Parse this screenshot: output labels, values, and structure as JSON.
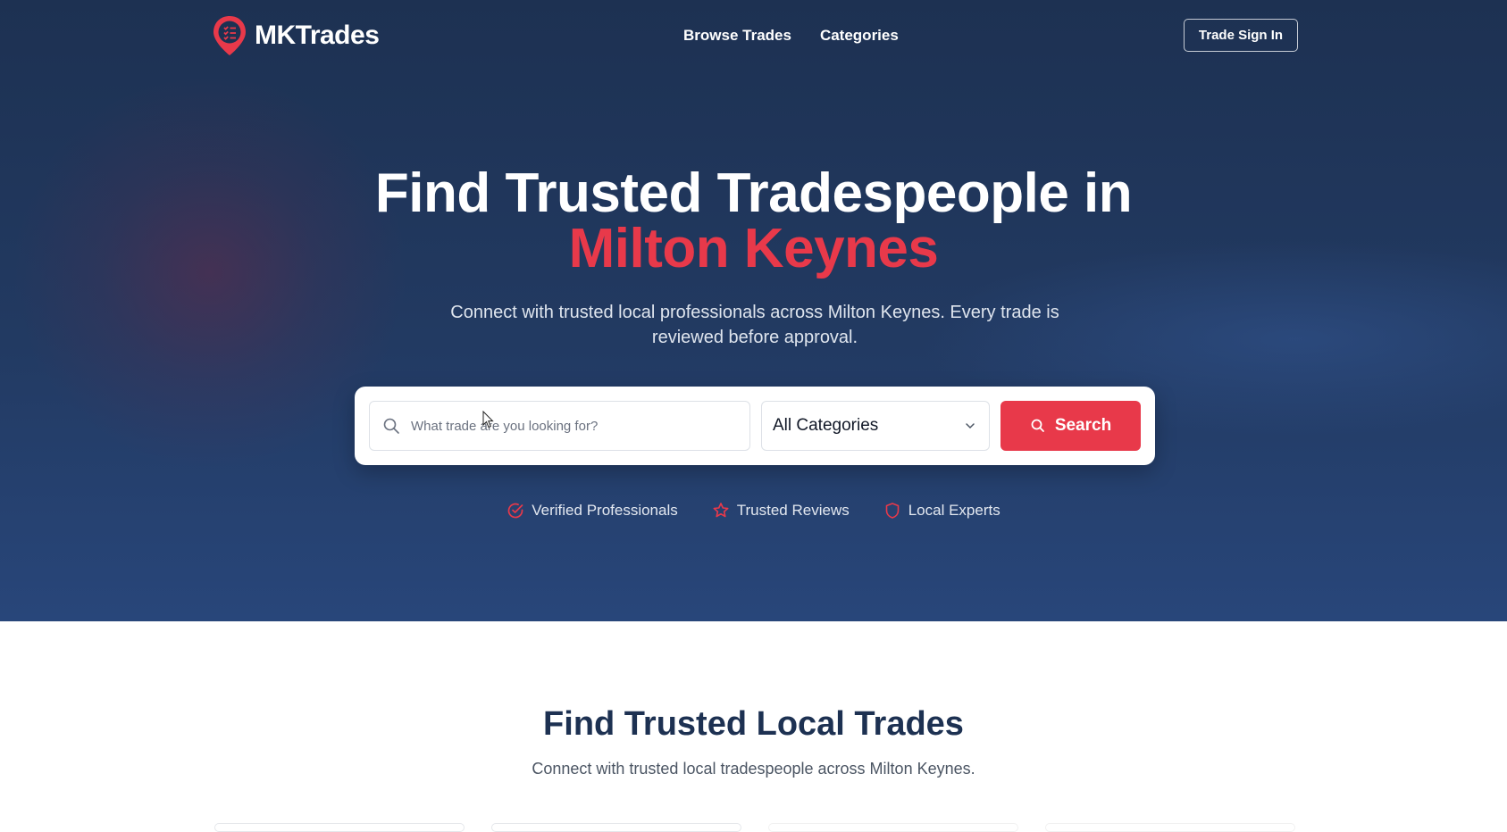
{
  "header": {
    "brand": "MKTrades",
    "nav": [
      "Browse Trades",
      "Categories"
    ],
    "signin_label": "Trade Sign In"
  },
  "hero": {
    "headline": "Find Trusted Tradespeople in",
    "headline_accent": "Milton Keynes",
    "subtitle": "Connect with trusted local professionals across Milton Keynes. Every trade is reviewed before approval."
  },
  "search": {
    "placeholder": "What trade are you looking for?",
    "value": "",
    "category_selected": "All Categories",
    "button_label": "Search"
  },
  "features": [
    {
      "icon": "check-circle-icon",
      "label": "Verified Professionals"
    },
    {
      "icon": "star-icon",
      "label": "Trusted Reviews"
    },
    {
      "icon": "shield-icon",
      "label": "Local Experts"
    }
  ],
  "section": {
    "title": "Find Trusted Local Trades",
    "subtitle": "Connect with trusted local tradespeople across Milton Keynes."
  },
  "colors": {
    "accent": "#e8394a",
    "navy": "#1d3152",
    "white": "#ffffff"
  }
}
